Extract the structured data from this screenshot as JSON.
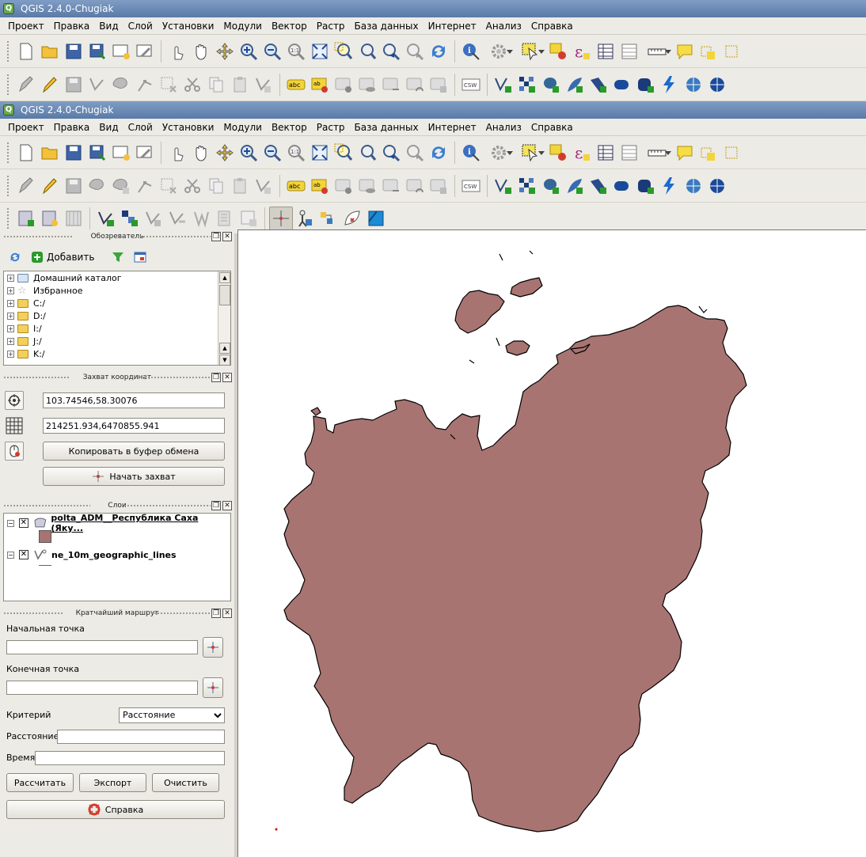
{
  "app": {
    "title": "QGIS 2.4.0-Chugiak"
  },
  "menu": [
    "Проект",
    "Правка",
    "Вид",
    "Слой",
    "Установки",
    "Модули",
    "Вектор",
    "Растр",
    "База данных",
    "Интернет",
    "Анализ",
    "Справка"
  ],
  "browser": {
    "title": "Обозреватель",
    "add_label": "Добавить",
    "items": [
      "Домашний каталог",
      "Избранное",
      "C:/",
      "D:/",
      "I:/",
      "J:/",
      "K:/"
    ]
  },
  "coord_capture": {
    "title": "Захват координат",
    "geo_value": "103.74546,58.30076",
    "proj_value": "214251.934,6470855.941",
    "copy_label": "Копировать в буфер обмена",
    "start_label": "Начать захват"
  },
  "layers": {
    "title": "Слои",
    "items": [
      {
        "name": "polta_ADM__Республика Саха (Яку...",
        "fill": "#a87472"
      },
      {
        "name": "ne_10m_geographic_lines",
        "fill": "#3a6db0"
      }
    ]
  },
  "route": {
    "title": "Кратчайший маршрут",
    "start_label": "Начальная точка",
    "end_label": "Конечная точка",
    "criterion_label": "Критерий",
    "criterion_value": "Расстояние",
    "distance_label": "Расстояние",
    "time_label": "Время",
    "calc_label": "Рассчитать",
    "export_label": "Экспорт",
    "clear_label": "Очистить",
    "help_label": "Справка"
  },
  "map": {
    "polygon_fill": "#a87472",
    "outline": "#000000"
  }
}
